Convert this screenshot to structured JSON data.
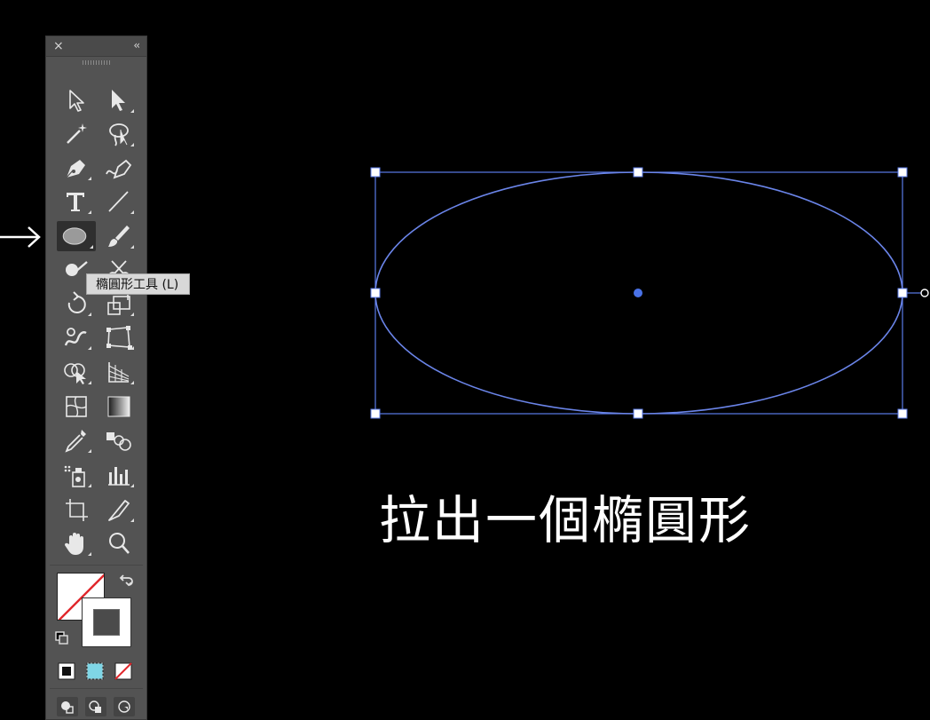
{
  "toolbar": {
    "close_glyph": "×",
    "collapse_glyph": "‹‹",
    "tools": [
      {
        "name": "selection-tool",
        "icon": "selection-arrow-icon"
      },
      {
        "name": "direct-selection-tool",
        "icon": "direct-selection-arrow-icon"
      },
      {
        "name": "magic-wand-tool",
        "icon": "magic-wand-icon"
      },
      {
        "name": "lasso-tool",
        "icon": "lasso-icon"
      },
      {
        "name": "pen-tool",
        "icon": "pen-icon"
      },
      {
        "name": "curvature-tool",
        "icon": "curvature-pen-icon"
      },
      {
        "name": "type-tool",
        "icon": "type-icon"
      },
      {
        "name": "line-segment-tool",
        "icon": "line-segment-icon"
      },
      {
        "name": "ellipse-tool",
        "icon": "ellipse-icon",
        "active": true
      },
      {
        "name": "paintbrush-tool",
        "icon": "paintbrush-icon"
      },
      {
        "name": "shaper-tool",
        "icon": "shaper-icon"
      },
      {
        "name": "scissors-tool",
        "icon": "scissors-icon"
      },
      {
        "name": "rotate-tool",
        "icon": "rotate-icon"
      },
      {
        "name": "scale-tool",
        "icon": "scale-icon"
      },
      {
        "name": "warp-tool",
        "icon": "warp-icon"
      },
      {
        "name": "free-transform-tool",
        "icon": "free-transform-icon"
      },
      {
        "name": "shape-builder-tool",
        "icon": "shape-builder-icon"
      },
      {
        "name": "perspective-grid-tool",
        "icon": "perspective-grid-icon"
      },
      {
        "name": "mesh-tool",
        "icon": "mesh-icon"
      },
      {
        "name": "gradient-tool",
        "icon": "gradient-icon"
      },
      {
        "name": "eyedropper-tool",
        "icon": "eyedropper-icon"
      },
      {
        "name": "blend-tool",
        "icon": "blend-icon"
      },
      {
        "name": "symbol-sprayer-tool",
        "icon": "symbol-sprayer-icon"
      },
      {
        "name": "column-graph-tool",
        "icon": "column-graph-icon"
      },
      {
        "name": "artboard-tool",
        "icon": "artboard-icon"
      },
      {
        "name": "slice-tool",
        "icon": "slice-knife-icon"
      },
      {
        "name": "hand-tool",
        "icon": "hand-icon"
      },
      {
        "name": "zoom-tool",
        "icon": "zoom-icon"
      }
    ],
    "colors": {
      "fill": "#ffffff",
      "none_slash": "#e0262b",
      "stroke_inner": "#4b4b4b",
      "gradient_swatch": "#7fd6e6"
    }
  },
  "tooltip": {
    "text": "橢圓形工具 (L)"
  },
  "canvas": {
    "accent": "#5b7be8",
    "caption": "拉出一個橢圓形"
  }
}
